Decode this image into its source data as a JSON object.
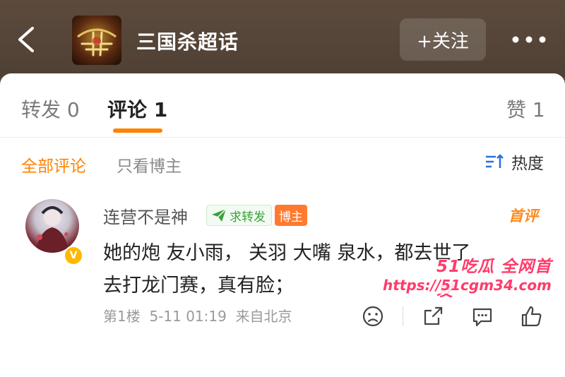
{
  "header": {
    "back_icon": "chevron-left-icon",
    "title": "三国杀超话",
    "follow_label": "+关注",
    "more_icon": "ellipsis-icon"
  },
  "tabs": [
    {
      "label": "转发 0",
      "active": false
    },
    {
      "label": "评论 1",
      "active": true
    },
    {
      "label": "赞 1",
      "active": false
    }
  ],
  "filters": {
    "all_label": "全部评论",
    "owner_only_label": "只看博主",
    "sort_label": "热度",
    "sort_icon": "sort-icon"
  },
  "comment": {
    "username": "连营不是神",
    "repost_tag": "求转发",
    "owner_tag": "博主",
    "first_tag": "首评",
    "verified_badge": "V",
    "text": "她的炮 友小雨， 关羽 大嘴 泉水，都去世了\n去打龙门赛，真有脸；",
    "floor": "第1楼",
    "datetime": "5-11 01:19",
    "location": "来自北京"
  },
  "watermark": {
    "brand": "51吃瓜 全网首发",
    "url": "https://51cgm34.com"
  },
  "colors": {
    "accent": "#ff8200",
    "header_bg": "#574637",
    "owner_tag": "#ff7a2e",
    "watermark": "#ff3b6b"
  }
}
